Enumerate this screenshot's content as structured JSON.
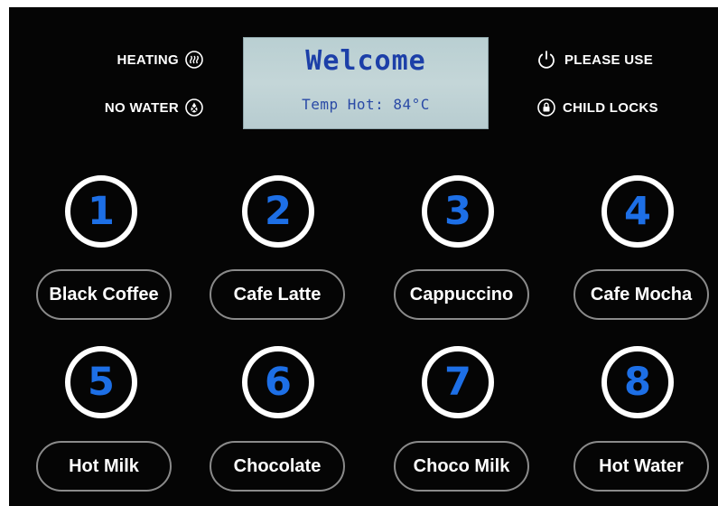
{
  "status": {
    "heating": {
      "label": "HEATING",
      "icon": "heating-icon"
    },
    "no_water": {
      "label": "NO WATER",
      "icon": "water-drop-icon"
    },
    "please_use": {
      "label": "PLEASE USE",
      "icon": "power-icon"
    },
    "child_locks": {
      "label": "CHILD LOCKS",
      "icon": "lock-icon"
    }
  },
  "display": {
    "title": "Welcome",
    "subtitle": "Temp Hot: 84°C"
  },
  "numbers": [
    "1",
    "2",
    "3",
    "4",
    "5",
    "6",
    "7",
    "8"
  ],
  "drinks": [
    "Black Coffee",
    "Cafe Latte",
    "Cappuccino",
    "Cafe Mocha",
    "Hot Milk",
    "Chocolate",
    "Choco Milk",
    "Hot Water"
  ],
  "colors": {
    "panel": "#050505",
    "number": "#1d6fe6",
    "lcd_text": "#1c3fa8",
    "lcd_bg": "#c4d6d8"
  }
}
